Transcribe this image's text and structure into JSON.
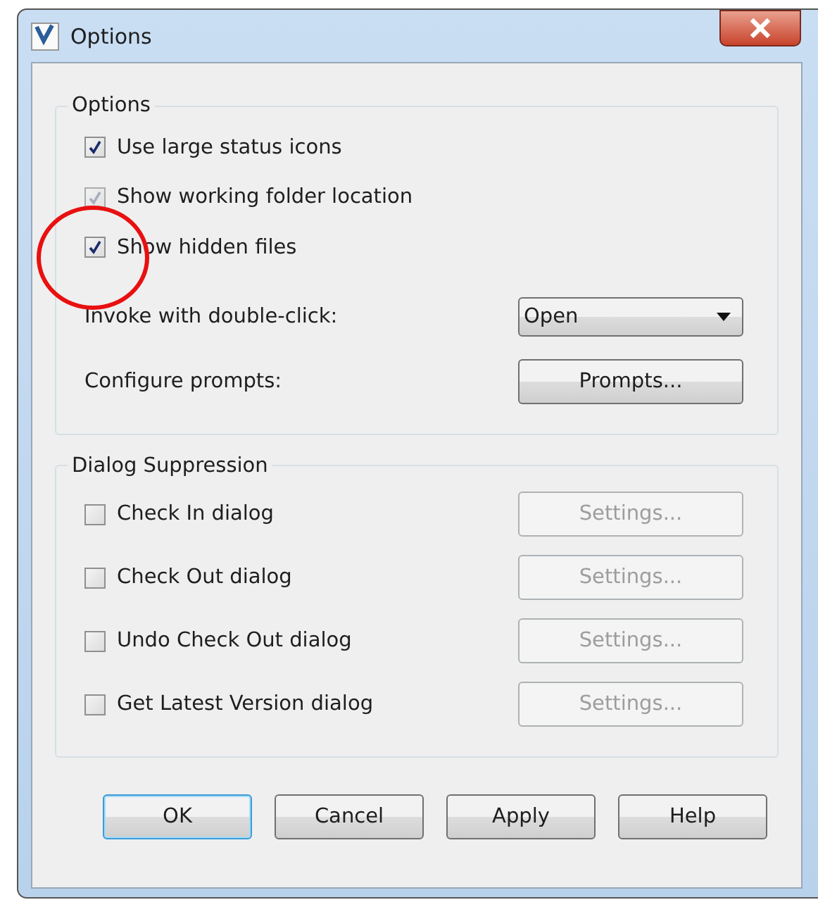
{
  "window": {
    "title": "Options"
  },
  "options": {
    "title": "Options",
    "checkboxes": [
      {
        "label": "Use large status icons",
        "checked": true,
        "disabled": false
      },
      {
        "label": "Show working folder location",
        "checked": true,
        "disabled": true
      },
      {
        "label": "Show hidden files",
        "checked": true,
        "disabled": false
      }
    ],
    "invoke": {
      "label": "Invoke with double-click:",
      "value": "Open"
    },
    "prompts": {
      "label": "Configure prompts:",
      "button": "Prompts..."
    }
  },
  "suppression": {
    "title": "Dialog Suppression",
    "rows": [
      {
        "label": "Check In dialog",
        "checked": false,
        "button": "Settings...",
        "button_disabled": true
      },
      {
        "label": "Check Out dialog",
        "checked": false,
        "button": "Settings...",
        "button_disabled": true
      },
      {
        "label": "Undo Check Out dialog",
        "checked": false,
        "button": "Settings...",
        "button_disabled": true
      },
      {
        "label": "Get Latest Version dialog",
        "checked": false,
        "button": "Settings...",
        "button_disabled": true
      }
    ]
  },
  "buttons": [
    {
      "label": "OK",
      "default": true
    },
    {
      "label": "Cancel",
      "default": false
    },
    {
      "label": "Apply",
      "default": false
    },
    {
      "label": "Help",
      "default": false
    }
  ]
}
